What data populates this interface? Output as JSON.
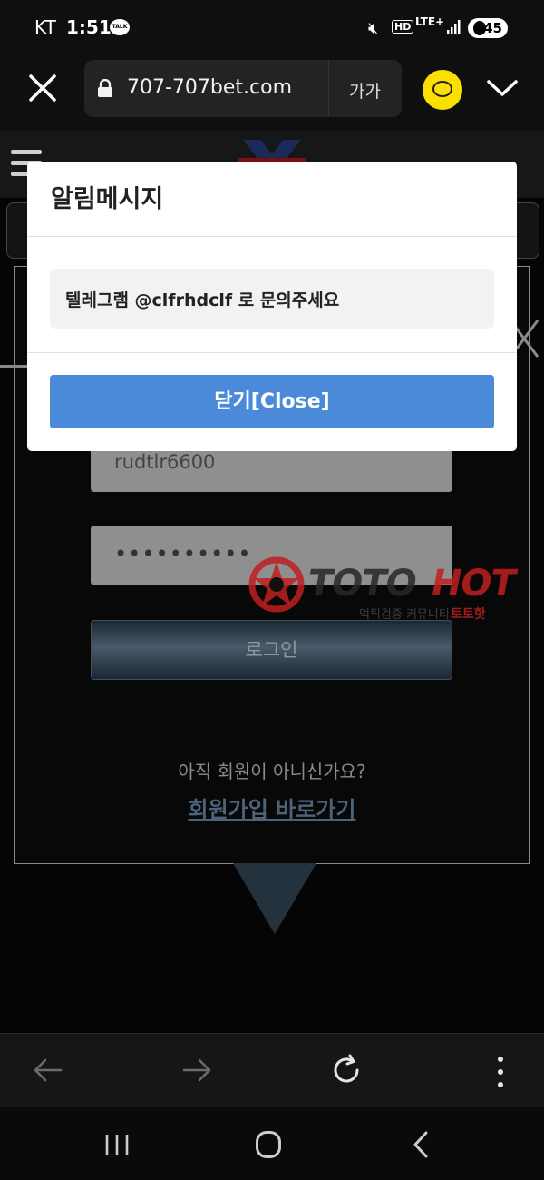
{
  "status_bar": {
    "carrier": "KT",
    "time": "1:51",
    "talk_badge": "TALK",
    "hd_label": "HD",
    "network_label": "LTE+",
    "battery_level": "45"
  },
  "browser": {
    "url": "707-707bet.com",
    "text_size_label": "가가"
  },
  "login": {
    "userid_value": "rudtlr6600",
    "password_value": "••••••••••",
    "login_button_label": "로그인",
    "signup_question": "아직 회원이 아니신가요?",
    "signup_link_label": "회원가입 바로가기"
  },
  "watermark": {
    "brand_part_1": "TOTO",
    "brand_part_2": "HOT",
    "sub_label": "먹튀검증 커뮤니티",
    "sub_label_red": "토토핫"
  },
  "modal": {
    "title": "알림메시지",
    "message": "텔레그램 @clfrhdclf 로 문의주세요",
    "close_label": "닫기[Close]"
  },
  "colors": {
    "modal_button": "#4a8ad9",
    "chat_icon": "#f9e000",
    "watermark_red": "#be1e1e"
  }
}
